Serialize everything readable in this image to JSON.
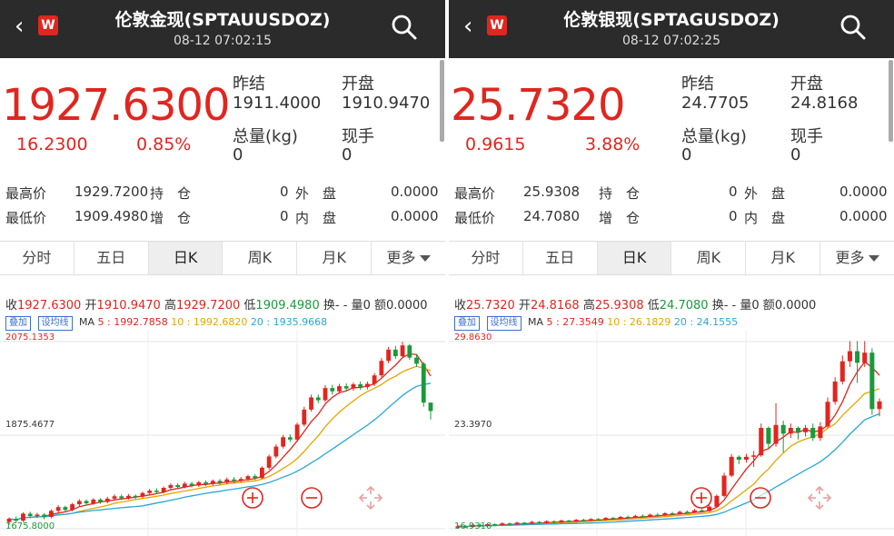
{
  "panels": [
    {
      "title": "伦敦金现(SPTAUUSDOZ)",
      "time": "08-12 07:02:15",
      "logo": "W",
      "price": "1927.6300",
      "change": "16.2300",
      "change_pct": "0.85%",
      "prev_close_label": "昨结",
      "prev_close": "1911.4000",
      "open_label": "开盘",
      "open": "1910.9470",
      "volume_label": "总量(kg)",
      "volume": "0",
      "current_label": "现手",
      "current": "0",
      "stats": {
        "high_label": "最高价",
        "high": "1929.7200",
        "low_label": "最低价",
        "low": "1909.4980",
        "hold_label": "持　仓",
        "hold": "0",
        "inc_label": "增　仓",
        "inc": "0",
        "outer_label": "外　盘",
        "outer": "0.0000",
        "inner_label": "内　盘",
        "inner": "0.0000"
      },
      "tabs": [
        "分时",
        "五日",
        "日K",
        "周K",
        "月K",
        "更多"
      ],
      "active_tab": 2,
      "ohlc": {
        "close_label": "收",
        "close": "1927.6300",
        "open_label": "开",
        "open": "1910.9470",
        "high_label": "高",
        "high": "1929.7200",
        "low_label": "低",
        "low": "1909.4980",
        "turn_label": "换",
        "turn": "- -",
        "vol_label": "量",
        "vol": "0",
        "amt_label": "额",
        "amt": "0.0000"
      },
      "overlay_btn": "叠加",
      "ma_btn": "设均线",
      "ma_label": "MA",
      "ma5": "5 : 1992.7858",
      "ma10": "10 : 1992.6820",
      "ma20": "20 : 1935.9668",
      "axis_top": "2075.1353",
      "axis_mid": "1875.4677",
      "axis_bottom": "1675.8000",
      "colors": {
        "up": "#e0261f",
        "down": "#1a9a3a",
        "ma5": "#e0261f",
        "ma10": "#e6a500",
        "ma20": "#2aa6d8"
      },
      "chart_data": {
        "type": "candlestick",
        "candles": [
          [
            1690,
            1697,
            1684,
            1700
          ],
          [
            1697,
            1693,
            1688,
            1702
          ],
          [
            1693,
            1708,
            1690,
            1711
          ],
          [
            1708,
            1703,
            1698,
            1712
          ],
          [
            1703,
            1706,
            1699,
            1710
          ],
          [
            1706,
            1701,
            1696,
            1709
          ],
          [
            1701,
            1714,
            1698,
            1717
          ],
          [
            1714,
            1722,
            1710,
            1726
          ],
          [
            1722,
            1716,
            1712,
            1725
          ],
          [
            1716,
            1728,
            1713,
            1731
          ],
          [
            1728,
            1735,
            1724,
            1739
          ],
          [
            1735,
            1730,
            1726,
            1738
          ],
          [
            1730,
            1738,
            1727,
            1741
          ],
          [
            1738,
            1733,
            1729,
            1741
          ],
          [
            1733,
            1740,
            1730,
            1744
          ],
          [
            1740,
            1745,
            1736,
            1749
          ],
          [
            1745,
            1741,
            1737,
            1749
          ],
          [
            1741,
            1746,
            1738,
            1750
          ],
          [
            1746,
            1744,
            1739,
            1749
          ],
          [
            1744,
            1752,
            1741,
            1755
          ],
          [
            1752,
            1757,
            1748,
            1761
          ],
          [
            1757,
            1754,
            1750,
            1762
          ],
          [
            1754,
            1763,
            1751,
            1766
          ],
          [
            1763,
            1769,
            1759,
            1773
          ],
          [
            1769,
            1765,
            1760,
            1773
          ],
          [
            1765,
            1772,
            1762,
            1776
          ],
          [
            1772,
            1768,
            1764,
            1776
          ],
          [
            1768,
            1775,
            1765,
            1778
          ],
          [
            1775,
            1771,
            1767,
            1779
          ],
          [
            1771,
            1778,
            1768,
            1781
          ],
          [
            1778,
            1774,
            1770,
            1782
          ],
          [
            1774,
            1781,
            1771,
            1785
          ],
          [
            1781,
            1778,
            1774,
            1786
          ],
          [
            1778,
            1782,
            1775,
            1786
          ],
          [
            1782,
            1788,
            1778,
            1791
          ],
          [
            1788,
            1784,
            1780,
            1792
          ],
          [
            1784,
            1806,
            1782,
            1809
          ],
          [
            1806,
            1830,
            1802,
            1834
          ],
          [
            1830,
            1851,
            1826,
            1856
          ],
          [
            1851,
            1871,
            1847,
            1876
          ],
          [
            1871,
            1866,
            1861,
            1877
          ],
          [
            1866,
            1898,
            1862,
            1902
          ],
          [
            1898,
            1930,
            1894,
            1936
          ],
          [
            1930,
            1956,
            1926,
            1962
          ],
          [
            1956,
            1950,
            1944,
            1962
          ],
          [
            1950,
            1976,
            1946,
            1982
          ],
          [
            1976,
            1969,
            1962,
            1983
          ],
          [
            1969,
            1980,
            1964,
            1985
          ],
          [
            1980,
            1975,
            1969,
            1986
          ],
          [
            1975,
            1984,
            1970,
            1988
          ],
          [
            1984,
            1978,
            1972,
            1990
          ],
          [
            1978,
            1985,
            1973,
            1990
          ],
          [
            1985,
            2003,
            1980,
            2008
          ],
          [
            2003,
            2034,
            1999,
            2040
          ],
          [
            2034,
            2058,
            2029,
            2064
          ],
          [
            2058,
            2044,
            2038,
            2066
          ],
          [
            2044,
            2067,
            2040,
            2075
          ],
          [
            2067,
            2041,
            2036,
            2070
          ],
          [
            2041,
            2028,
            2021,
            2048
          ],
          [
            2028,
            1945,
            1936,
            2032
          ],
          [
            1945,
            1927,
            1909,
            1930
          ]
        ],
        "ylim": [
          1675.8,
          2075.1353
        ]
      }
    },
    {
      "title": "伦敦银现(SPTAGUSDOZ)",
      "time": "08-12 07:02:25",
      "logo": "W",
      "price": "25.7320",
      "change": "0.9615",
      "change_pct": "3.88%",
      "prev_close_label": "昨结",
      "prev_close": "24.7705",
      "open_label": "开盘",
      "open": "24.8168",
      "volume_label": "总量(kg)",
      "volume": "0",
      "current_label": "现手",
      "current": "0",
      "stats": {
        "high_label": "最高价",
        "high": "25.9308",
        "low_label": "最低价",
        "low": "24.7080",
        "hold_label": "持　仓",
        "hold": "0",
        "inc_label": "增　仓",
        "inc": "0",
        "outer_label": "外　盘",
        "outer": "0.0000",
        "inner_label": "内　盘",
        "inner": "0.0000"
      },
      "tabs": [
        "分时",
        "五日",
        "日K",
        "周K",
        "月K",
        "更多"
      ],
      "active_tab": 2,
      "ohlc": {
        "close_label": "收",
        "close": "25.7320",
        "open_label": "开",
        "open": "24.8168",
        "high_label": "高",
        "high": "25.9308",
        "low_label": "低",
        "low": "24.7080",
        "turn_label": "换",
        "turn": "- -",
        "vol_label": "量",
        "vol": "0",
        "amt_label": "额",
        "amt": "0.0000"
      },
      "overlay_btn": "叠加",
      "ma_btn": "设均线",
      "ma_label": "MA",
      "ma5": "5 : 27.3549",
      "ma10": "10 : 26.1829",
      "ma20": "20 : 24.1555",
      "axis_top": "29.8630",
      "axis_mid": "23.3970",
      "axis_bottom": "16.9310",
      "colors": {
        "up": "#e0261f",
        "down": "#1a9a3a",
        "ma5": "#e0261f",
        "ma10": "#e6a500",
        "ma20": "#2aa6d8"
      },
      "chart_data": {
        "type": "candlestick",
        "candles": [
          [
            17.0,
            17.1,
            16.95,
            17.2
          ],
          [
            17.1,
            17.05,
            16.98,
            17.18
          ],
          [
            17.05,
            17.2,
            17.0,
            17.3
          ],
          [
            17.2,
            17.12,
            17.05,
            17.28
          ],
          [
            17.12,
            17.25,
            17.08,
            17.32
          ],
          [
            17.25,
            17.18,
            17.1,
            17.3
          ],
          [
            17.18,
            17.3,
            17.12,
            17.38
          ],
          [
            17.3,
            17.22,
            17.15,
            17.36
          ],
          [
            17.22,
            17.35,
            17.18,
            17.42
          ],
          [
            17.35,
            17.28,
            17.2,
            17.4
          ],
          [
            17.28,
            17.4,
            17.24,
            17.48
          ],
          [
            17.4,
            17.32,
            17.26,
            17.46
          ],
          [
            17.32,
            17.45,
            17.28,
            17.52
          ],
          [
            17.45,
            17.38,
            17.3,
            17.5
          ],
          [
            17.38,
            17.5,
            17.33,
            17.56
          ],
          [
            17.5,
            17.42,
            17.36,
            17.55
          ],
          [
            17.42,
            17.55,
            17.38,
            17.6
          ],
          [
            17.55,
            17.5,
            17.43,
            17.62
          ],
          [
            17.5,
            17.6,
            17.45,
            17.66
          ],
          [
            17.6,
            17.55,
            17.48,
            17.67
          ],
          [
            17.55,
            17.68,
            17.5,
            17.74
          ],
          [
            17.68,
            17.62,
            17.56,
            17.75
          ],
          [
            17.62,
            17.75,
            17.58,
            17.82
          ],
          [
            17.75,
            17.7,
            17.62,
            17.84
          ],
          [
            17.7,
            17.82,
            17.66,
            17.9
          ],
          [
            17.82,
            17.78,
            17.7,
            17.92
          ],
          [
            17.78,
            17.9,
            17.73,
            17.98
          ],
          [
            17.9,
            17.85,
            17.8,
            18.0
          ],
          [
            17.85,
            18.0,
            17.8,
            18.08
          ],
          [
            18.0,
            17.95,
            17.88,
            18.1
          ],
          [
            17.95,
            18.1,
            17.9,
            18.18
          ],
          [
            18.1,
            18.05,
            17.98,
            18.2
          ],
          [
            18.05,
            18.2,
            18.0,
            18.3
          ],
          [
            18.2,
            18.15,
            18.08,
            18.32
          ],
          [
            18.15,
            18.45,
            18.1,
            18.55
          ],
          [
            18.45,
            19.2,
            18.4,
            19.3
          ],
          [
            19.2,
            20.6,
            19.1,
            20.8
          ],
          [
            20.6,
            21.9,
            20.5,
            22.1
          ],
          [
            21.9,
            21.7,
            21.4,
            22.0
          ],
          [
            21.7,
            21.9,
            21.5,
            22.1
          ],
          [
            21.9,
            22.0,
            21.2,
            22.3
          ],
          [
            22.0,
            23.9,
            21.9,
            24.2
          ],
          [
            23.9,
            22.8,
            22.5,
            24.0
          ],
          [
            22.8,
            24.1,
            22.6,
            25.6
          ],
          [
            24.1,
            23.5,
            22.2,
            24.4
          ],
          [
            23.5,
            23.9,
            23.2,
            24.2
          ],
          [
            23.9,
            23.6,
            23.1,
            24.0
          ],
          [
            23.6,
            23.9,
            23.3,
            24.1
          ],
          [
            23.9,
            23.2,
            23.0,
            24.2
          ],
          [
            23.2,
            24.0,
            23.0,
            24.3
          ],
          [
            24.0,
            25.7,
            23.9,
            26.0
          ],
          [
            25.7,
            27.1,
            25.5,
            27.4
          ],
          [
            27.1,
            28.5,
            26.9,
            28.9
          ],
          [
            28.5,
            29.2,
            28.1,
            29.9
          ],
          [
            29.2,
            28.4,
            27.0,
            29.9
          ],
          [
            28.4,
            29.1,
            28.1,
            29.9
          ],
          [
            29.1,
            25.2,
            24.8,
            29.4
          ],
          [
            25.2,
            25.73,
            24.7,
            25.93
          ]
        ],
        "ylim": [
          16.931,
          29.863
        ]
      }
    }
  ]
}
